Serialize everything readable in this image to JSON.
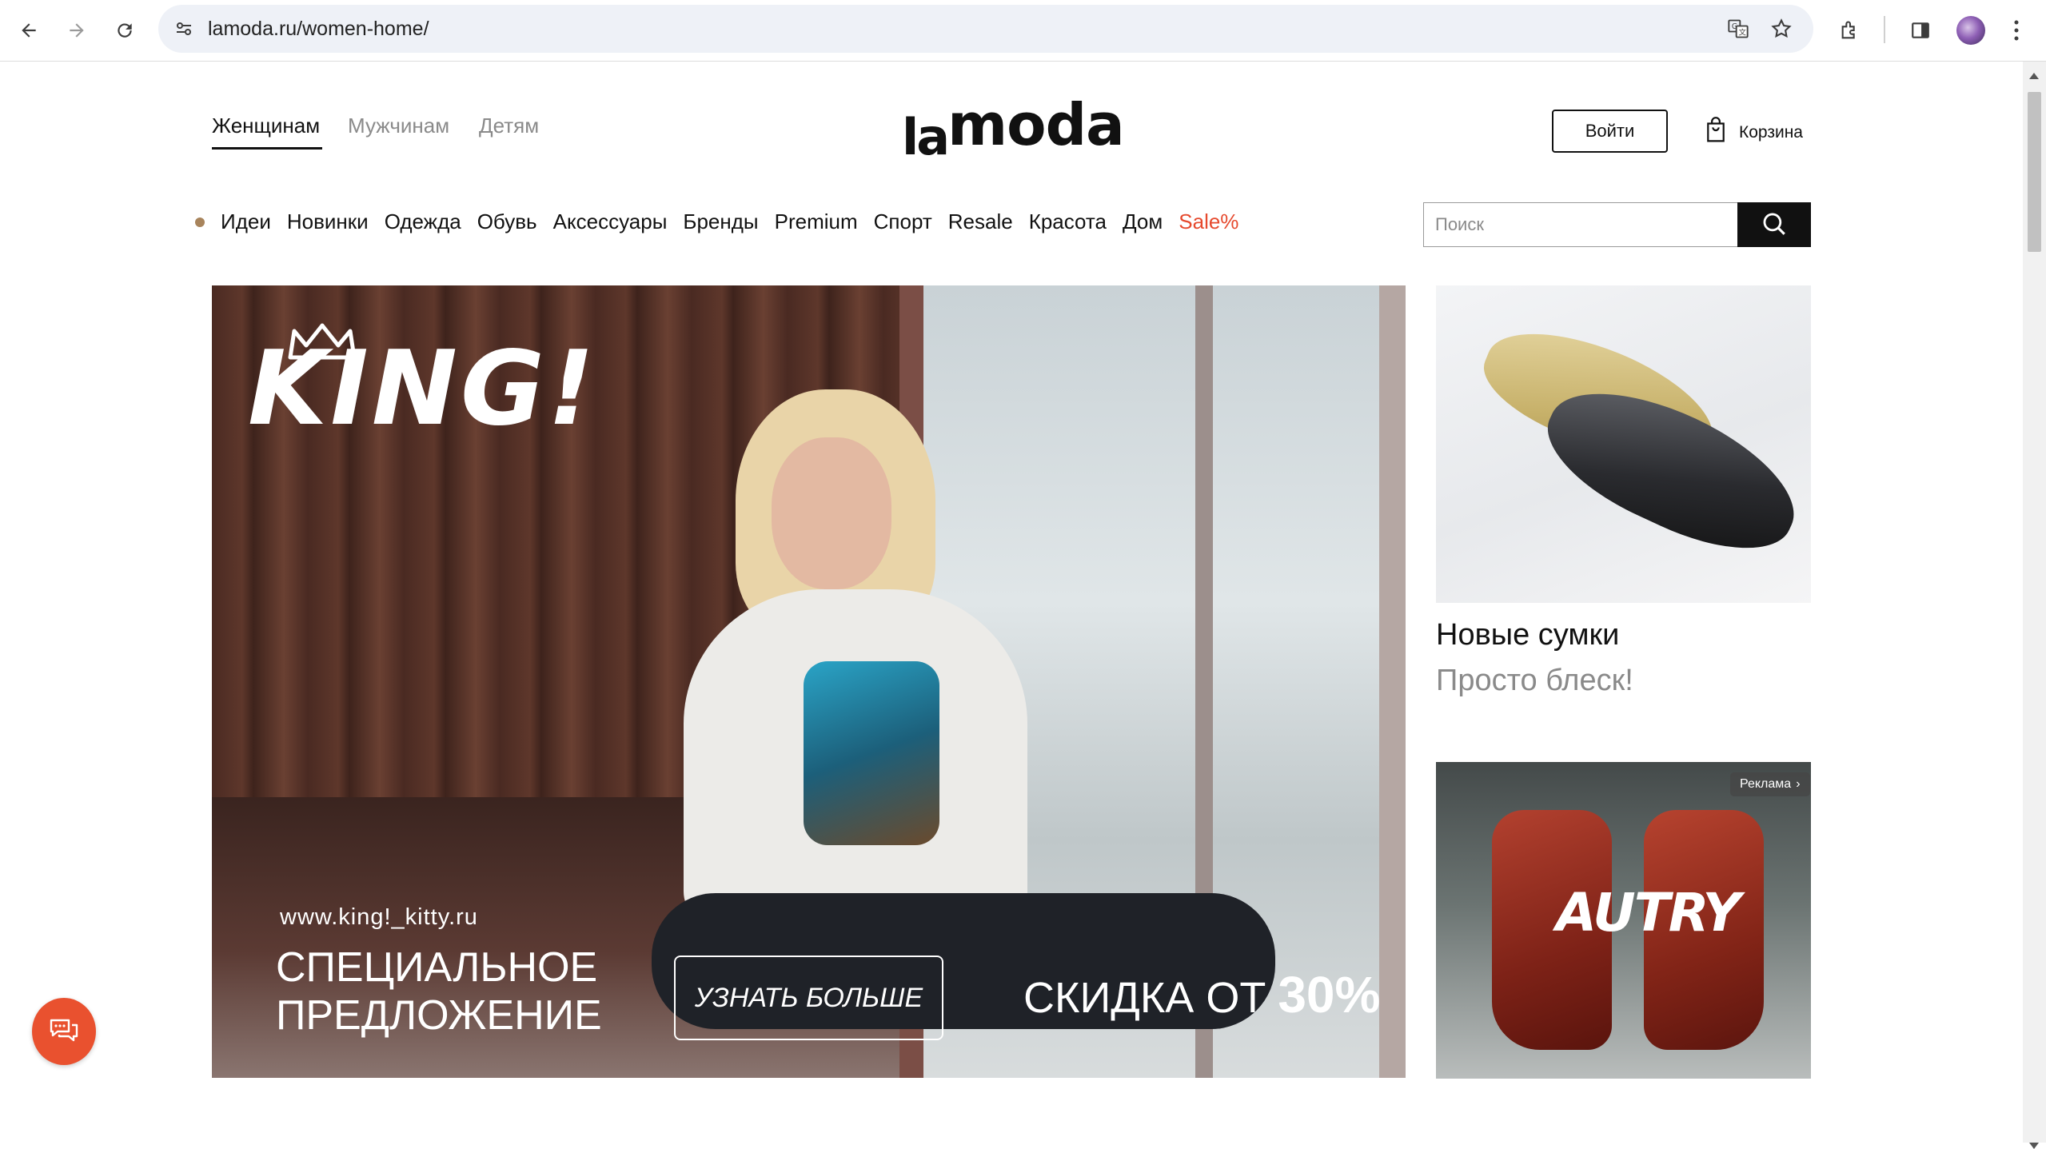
{
  "browser": {
    "url": "lamoda.ru/women-home/",
    "icons": [
      "back-arrow-icon",
      "forward-arrow-icon",
      "reload-icon",
      "site-settings-icon",
      "translate-icon",
      "star-icon",
      "extensions-icon",
      "side-panel-icon",
      "profile-avatar",
      "menu-dots-icon"
    ]
  },
  "header": {
    "tabs": [
      {
        "label": "Женщинам",
        "active": true
      },
      {
        "label": "Мужчинам",
        "active": false
      },
      {
        "label": "Детям",
        "active": false
      }
    ],
    "logo": {
      "la": "la",
      "moda": "moda"
    },
    "login_label": "Войти",
    "cart_label": "Корзина"
  },
  "menu": {
    "items": [
      "Идеи",
      "Новинки",
      "Одежда",
      "Обувь",
      "Аксессуары",
      "Бренды",
      "Premium",
      "Спорт",
      "Resale",
      "Красота",
      "Дом"
    ],
    "sale": "Sale%"
  },
  "search": {
    "placeholder": "Поиск"
  },
  "hero": {
    "brand": "KING!",
    "url": "www.king!_kitty.ru",
    "offer_line1": "СПЕЦИАЛЬНОЕ",
    "offer_line2": "ПРЕДЛОЖЕНИЕ",
    "cta": "УЗНАТЬ БОЛЬШЕ",
    "discount_prefix": "СКИДКА ОТ",
    "discount_value": "30%"
  },
  "promo_bags": {
    "title": "Новые сумки",
    "subtitle": "Просто блеск!"
  },
  "promo_autry": {
    "brand": "AUTRY",
    "ad_label": "Реклама"
  },
  "colors": {
    "accent_sale": "#e64a2e",
    "chat_button": "#e9512f",
    "text": "#111111",
    "muted": "#8a8a8a"
  }
}
